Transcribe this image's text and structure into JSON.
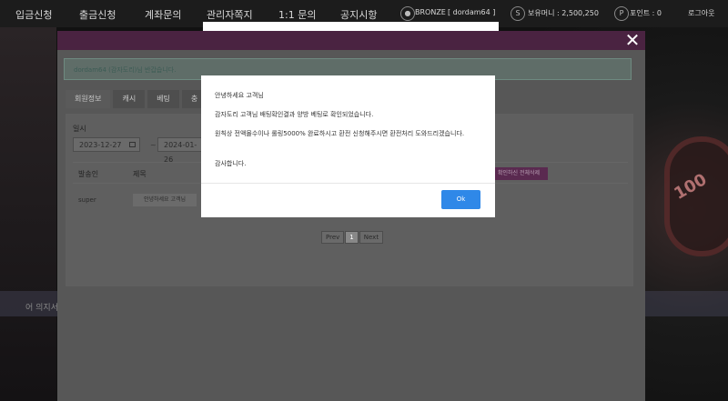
{
  "nav": {
    "items": [
      "입금신청",
      "출금신청",
      "계좌문의",
      "관리자쪽지",
      "1:1 문의",
      "공지시항"
    ],
    "user_badge": "BRONZE",
    "username": "[ dordam64 ]",
    "money_label": "보유머니 : 2,500,250",
    "point_label": "포인트 : 0",
    "logout": "로그아웃",
    "money_icon": "S",
    "point_icon": "P"
  },
  "background": {
    "stripe_text": "어 의지서",
    "chip_text": "100"
  },
  "window": {
    "close": "✕",
    "notice": "dordam64 (감자도리)님 반갑습니다.",
    "tabs": [
      "회원정보",
      "캐시",
      "베팅",
      "충"
    ],
    "date_label": "일시",
    "date_from": "2023-12-27",
    "date_to": "2024-01-26",
    "date_dash": "~",
    "columns": [
      "발송인",
      "제목"
    ],
    "delete_button": "확인하신 전체삭제",
    "row": {
      "sender": "super",
      "title": "안녕하세요 고객님"
    },
    "pager": {
      "prev": "Prev",
      "current": "1",
      "next": "Next"
    }
  },
  "dialog": {
    "line1": "안녕하세요 고객님",
    "line2": "감자도리 고객님 배팅확인결과 양방 베팅로 확인되었습니다.",
    "line3": "원칙상 전액몰수이나 롤링5000% 완료하시고 환전 신청해주시면 환전처리 도와드리겠습니다.",
    "line4": "감사합니다.",
    "ok": "Ok"
  }
}
